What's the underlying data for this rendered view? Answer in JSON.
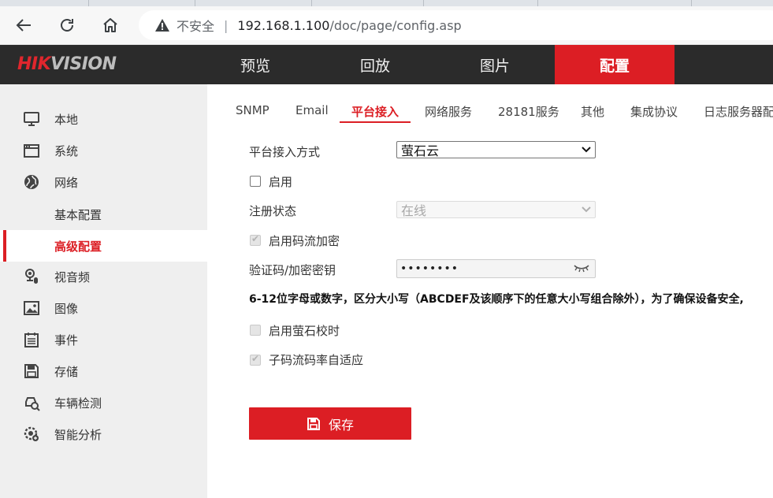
{
  "browser": {
    "security_label": "不安全",
    "url_host": "192.168.1.100",
    "url_path": "/doc/page/config.asp"
  },
  "header": {
    "logo_hik": "HIK",
    "logo_vision": "VISION",
    "nav": [
      "预览",
      "回放",
      "图片",
      "配置"
    ],
    "active_nav": "配置"
  },
  "sidebar": {
    "items": [
      {
        "label": "本地",
        "icon": "monitor-icon"
      },
      {
        "label": "系统",
        "icon": "window-icon"
      },
      {
        "label": "网络",
        "icon": "globe-icon"
      },
      {
        "label": "基本配置",
        "icon": ""
      },
      {
        "label": "高级配置",
        "icon": ""
      },
      {
        "label": "视音频",
        "icon": "camera-mic-icon"
      },
      {
        "label": "图像",
        "icon": "image-icon"
      },
      {
        "label": "事件",
        "icon": "calendar-icon"
      },
      {
        "label": "存储",
        "icon": "floppy-icon"
      },
      {
        "label": "车辆检测",
        "icon": "car-search-icon"
      },
      {
        "label": "智能分析",
        "icon": "gear-camera-icon"
      }
    ],
    "active": "高级配置"
  },
  "tabs": {
    "items": [
      "SNMP",
      "Email",
      "平台接入",
      "网络服务",
      "28181服务",
      "其他",
      "集成协议",
      "日志服务器配"
    ],
    "active": "平台接入"
  },
  "form": {
    "access_mode_label": "平台接入方式",
    "access_mode_value": "萤石云",
    "enable_label": "启用",
    "reg_status_label": "注册状态",
    "reg_status_value": "在线",
    "stream_encrypt_label": "启用码流加密",
    "verify_key_label": "验证码/加密密钥",
    "verify_key_value": "••••••••",
    "hint": "6-12位字母或数字，区分大小写（ABCDEF及该顺序下的任意大小写组合除外），为了确保设备安全,",
    "ezviz_time_label": "启用萤石校时",
    "substream_label": "子码流码率自适应",
    "save_label": "保存"
  },
  "colors": {
    "accent": "#dc1e24",
    "header_bg": "#2b2b2b",
    "sidebar_bg": "#efefef"
  }
}
